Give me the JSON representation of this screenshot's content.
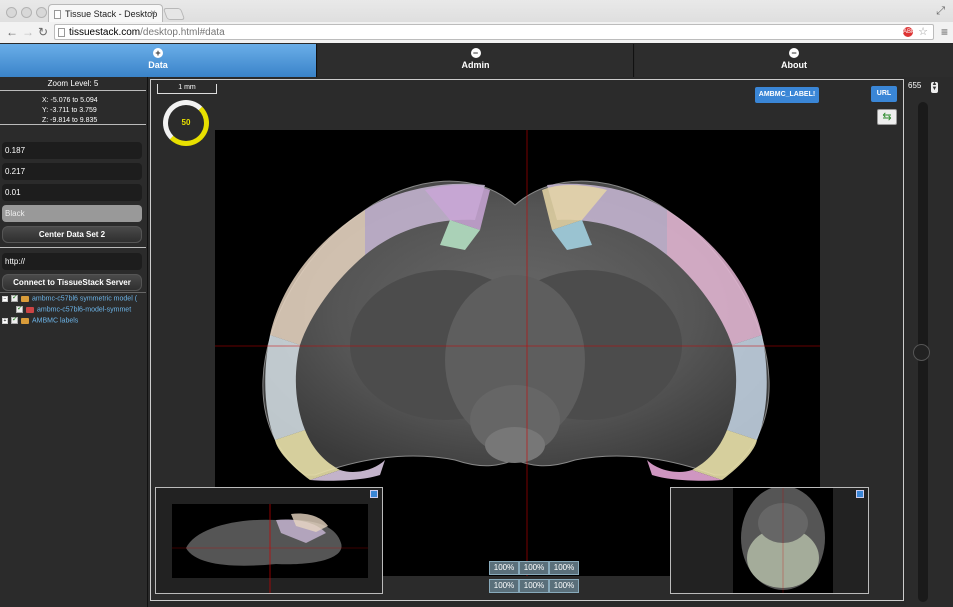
{
  "browser": {
    "tab_title": "Tissue Stack - Desktop",
    "url_host": "tissuestack.com",
    "url_path": "/desktop.html#data",
    "adblock_label": "ABP"
  },
  "app_tabs": [
    {
      "label": "Data",
      "icon": "+",
      "active": true
    },
    {
      "label": "Admin",
      "icon": "−",
      "active": false
    },
    {
      "label": "About",
      "icon": "−",
      "active": false
    }
  ],
  "left": {
    "zoom_level": "Zoom Level: 5",
    "coords": {
      "x": "X: -5.076 to 5.094",
      "y": "Y: -3.711 to 3.759",
      "z": "Z: -9.814 to 9.835"
    },
    "fields": [
      "0.187",
      "0.217",
      "0.01"
    ],
    "colormap": "Black",
    "center_button": "Center Data Set 2",
    "server_url": "http://",
    "connect_button": "Connect to TissueStack Server",
    "tree": [
      {
        "label": "ambmc-c57bl6 symmetric model (",
        "level": 0
      },
      {
        "label": "ambmc-c57bl6-model-symmet",
        "level": 1
      },
      {
        "label": "AMBMC labels",
        "level": 0
      }
    ]
  },
  "viewer": {
    "scale_bar": "1 mm",
    "ring_value": "50",
    "label_button": "AMBMC_LABEL!",
    "url_button": "URL",
    "percent_rows": [
      [
        "100%",
        "100%",
        "100%"
      ],
      [
        "100%",
        "100%",
        "100%"
      ]
    ],
    "colors": {
      "accent": "#3a86d6",
      "ring": "#e8e000",
      "crosshair": "#cc0000"
    }
  },
  "right": {
    "zoom_value": "655",
    "slider_fraction": 0.5
  }
}
